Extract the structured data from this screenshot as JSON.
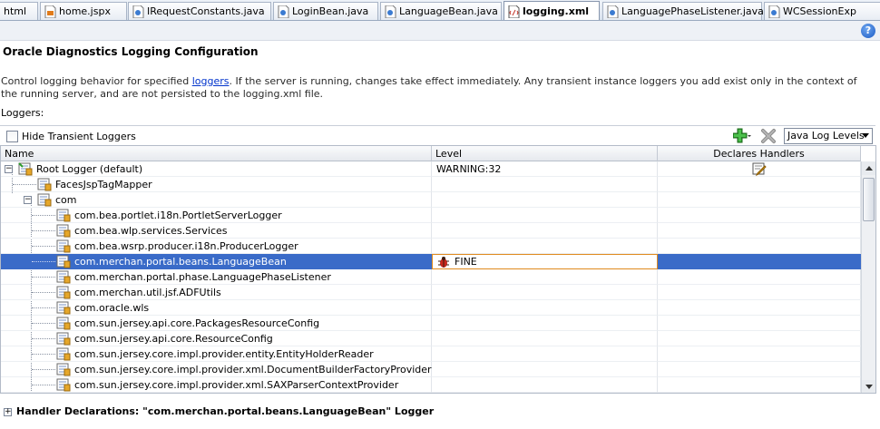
{
  "tabs": [
    {
      "label": "html",
      "icon": "none",
      "active": false
    },
    {
      "label": "home.jspx",
      "icon": "jspx-file-icon",
      "active": false
    },
    {
      "label": "IRequestConstants.java",
      "icon": "java-file-icon",
      "active": false
    },
    {
      "label": "LoginBean.java",
      "icon": "java-file-icon",
      "active": false
    },
    {
      "label": "LanguageBean.java",
      "icon": "java-file-icon",
      "active": false
    },
    {
      "label": "logging.xml",
      "icon": "xml-file-icon",
      "active": true
    },
    {
      "label": "LanguagePhaseListener.java",
      "icon": "java-file-icon",
      "active": false
    },
    {
      "label": "WCSessionExp",
      "icon": "java-file-icon",
      "active": false
    }
  ],
  "header": {
    "title": "Oracle Diagnostics Logging Configuration",
    "description_before_link": "Control logging behavior for specified ",
    "description_link": "loggers",
    "description_after_link": ". If the server is running, changes take effect immediately. Any transient instance loggers you add exist only in the context of the running server, and are not persisted to the logging.xml file.",
    "loggers_label": "Loggers:",
    "help_icon": "?"
  },
  "toolbar": {
    "hide_transient_label": "Hide Transient Loggers",
    "hide_transient_checked": false,
    "add_icon": "add-logger-icon",
    "remove_icon": "remove-logger-icon",
    "log_levels_value": "Java Log Levels"
  },
  "table": {
    "columns": {
      "name": "Name",
      "level": "Level",
      "declares_handlers": "Declares Handlers"
    },
    "rows": [
      {
        "name": "Root Logger (default)",
        "level": "WARNING:32",
        "declares_handlers": true
      },
      {
        "name": "FacesJspTagMapper",
        "level": "",
        "declares_handlers": false
      },
      {
        "name": "com",
        "level": "",
        "declares_handlers": false
      },
      {
        "name": "com.bea.portlet.i18n.PortletServerLogger",
        "level": "",
        "declares_handlers": false
      },
      {
        "name": "com.bea.wlp.services.Services",
        "level": "",
        "declares_handlers": false
      },
      {
        "name": "com.bea.wsrp.producer.i18n.ProducerLogger",
        "level": "",
        "declares_handlers": false
      },
      {
        "name": "com.merchan.portal.beans.LanguageBean",
        "level": "FINE",
        "declares_handlers": false,
        "selected": true
      },
      {
        "name": "com.merchan.portal.phase.LanguagePhaseListener",
        "level": "",
        "declares_handlers": false
      },
      {
        "name": "com.merchan.util.jsf.ADFUtils",
        "level": "",
        "declares_handlers": false
      },
      {
        "name": "com.oracle.wls",
        "level": "",
        "declares_handlers": false
      },
      {
        "name": "com.sun.jersey.api.core.PackagesResourceConfig",
        "level": "",
        "declares_handlers": false
      },
      {
        "name": "com.sun.jersey.api.core.ResourceConfig",
        "level": "",
        "declares_handlers": false
      },
      {
        "name": "com.sun.jersey.core.impl.provider.entity.EntityHolderReader",
        "level": "",
        "declares_handlers": false
      },
      {
        "name": "com.sun.jersey.core.impl.provider.xml.DocumentBuilderFactoryProvider",
        "level": "",
        "declares_handlers": false
      },
      {
        "name": "com.sun.jersey.core.impl.provider.xml.SAXParserContextProvider",
        "level": "",
        "declares_handlers": false
      }
    ]
  },
  "footer": {
    "handler_declarations_label": "Handler Declarations: \"com.merchan.portal.beans.LanguageBean\" Logger"
  },
  "colors": {
    "selection": "#3a6bc8",
    "level_edit_border": "#e08a1e",
    "link": "#0033cc"
  }
}
